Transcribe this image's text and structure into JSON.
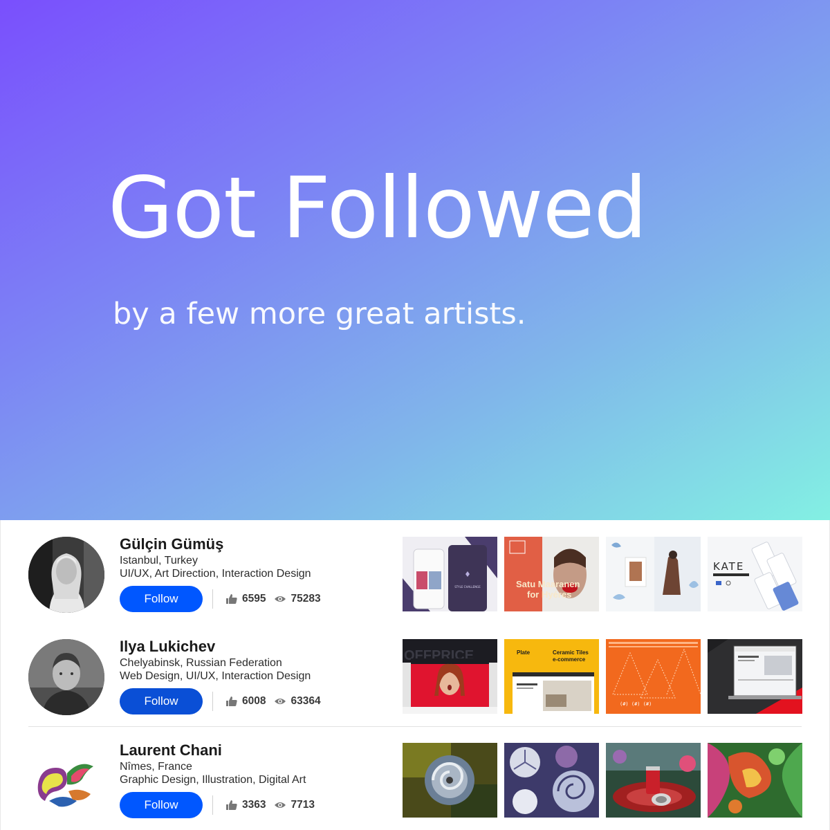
{
  "hero": {
    "title": "Got Followed",
    "subtitle": "by a few more great artists.",
    "gradient_colors": [
      "#7a4ffd",
      "#80b6ea",
      "#83f0e3"
    ]
  },
  "artists": [
    {
      "name": "Gülçin Gümüş",
      "location": "Istanbul, Turkey",
      "fields": "UI/UX, Art Direction, Interaction Design",
      "follow_label": "Follow",
      "appreciations": "6595",
      "views": "75283",
      "thumbnails": [
        {
          "icon": "mobile-fashion-app-thumbnail",
          "text": "STYLE CHALLENGE"
        },
        {
          "icon": "red-lips-portrait-thumbnail",
          "text": "Satu Maaranen for Hyéres"
        },
        {
          "icon": "fashion-lookbook-thumbnail",
          "text": ""
        },
        {
          "icon": "kate-ui-kit-thumbnail",
          "text": "KATE"
        }
      ]
    },
    {
      "name": "Ilya Lukichev",
      "location": "Chelyabinsk, Russian Federation",
      "fields": "Web Design, UI/UX, Interaction Design",
      "follow_label": "Follow",
      "appreciations": "6008",
      "views": "63364",
      "thumbnails": [
        {
          "icon": "surprised-woman-website-thumbnail",
          "text": "OFFPRICE"
        },
        {
          "icon": "ceramic-tiles-ecommerce-thumbnail",
          "text": "Plate Ceramic Tiles e-commerce"
        },
        {
          "icon": "orange-ascii-art-thumbnail",
          "text": ""
        },
        {
          "icon": "laptop-website-mockup-thumbnail",
          "text": ""
        }
      ]
    },
    {
      "name": "Laurent Chani",
      "location": "Nîmes, France",
      "fields": "Graphic Design, Illustration, Digital Art",
      "follow_label": "Follow",
      "appreciations": "3363",
      "views": "7713",
      "thumbnails": [
        {
          "icon": "fractal-swirl-thumbnail",
          "text": ""
        },
        {
          "icon": "fractal-snowflake-thumbnail",
          "text": ""
        },
        {
          "icon": "soda-can-digital-art-thumbnail",
          "text": ""
        },
        {
          "icon": "abstract-psychedelic-thumbnail",
          "text": ""
        }
      ]
    }
  ],
  "colors": {
    "follow_button": "#0057ff",
    "text_dark": "#1a1a1a"
  },
  "icons": {
    "appreciation": "thumbs-up-icon",
    "views": "eye-icon"
  }
}
